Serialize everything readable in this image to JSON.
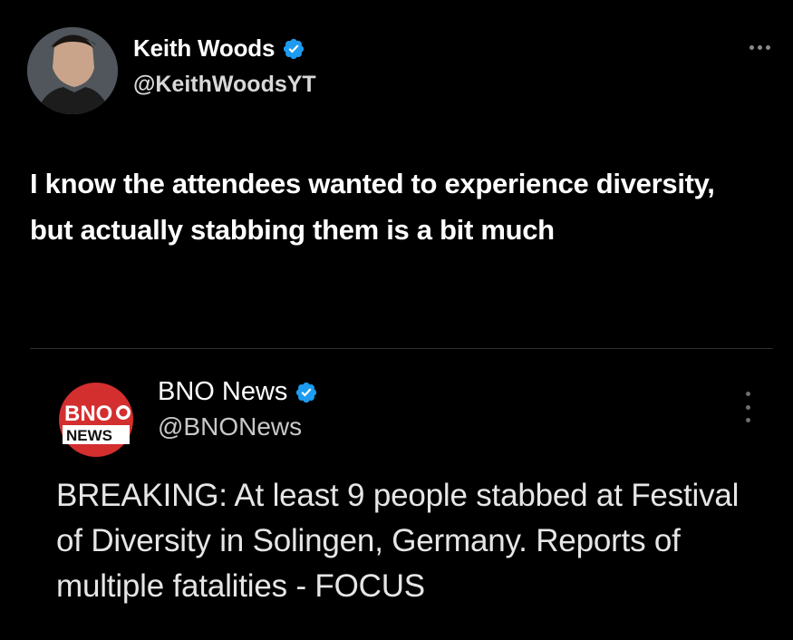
{
  "tweet": {
    "author_name": "Keith Woods",
    "author_handle": "@KeithWoodsYT",
    "text": "I know the attendees wanted to experience diversity, but actually stabbing them is a bit much",
    "verified_icon": "verified-badge-icon",
    "more_icon": "more-horizontal-icon"
  },
  "quoted_tweet": {
    "author_name": "BNO News",
    "author_handle": "@BNONews",
    "logo_text_top": "BNO",
    "logo_text_bottom": "NEWS",
    "text": "BREAKING: At least 9 people stabbed at Festival of Diversity in Solingen, Germany. Reports of multiple fatalities - FOCUS",
    "more_icon": "more-vertical-icon"
  },
  "colors": {
    "background": "#000000",
    "verified_blue": "#1d9bf0",
    "bno_red": "#d32f2f",
    "divider": "#2f2f2f"
  }
}
